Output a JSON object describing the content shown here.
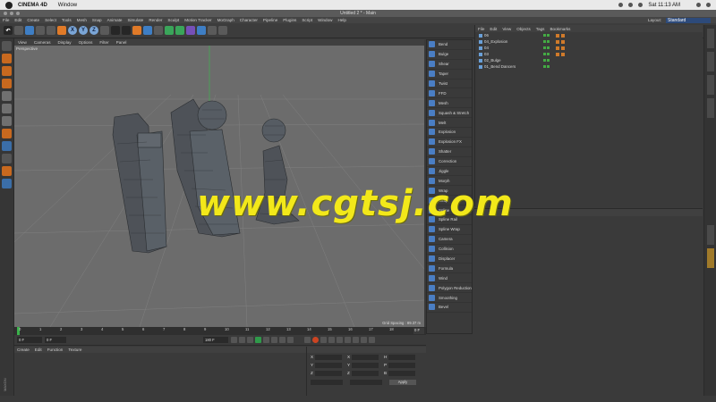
{
  "macbar": {
    "app_name": "CINEMA 4D",
    "menu": [
      "Window"
    ],
    "clock": "Sat 11:13 AM"
  },
  "window": {
    "title": "Untitled 2 * - Main"
  },
  "main_menu": {
    "items": [
      "File",
      "Edit",
      "Create",
      "Select",
      "Tools",
      "Mesh",
      "Snap",
      "Animate",
      "Simulate",
      "Render",
      "Sculpt",
      "Motion Tracker",
      "MoGraph",
      "Character",
      "Pipeline",
      "Plugins",
      "Script",
      "Window",
      "Help"
    ],
    "layout_label": "Layout:",
    "layout_value": "Standard"
  },
  "toolbar": {
    "axis_buttons": [
      "X",
      "Y",
      "Z"
    ]
  },
  "viewport": {
    "menu": [
      "View",
      "Cameras",
      "Display",
      "Options",
      "Filter",
      "Panel"
    ],
    "label": "Perspective",
    "grid_spacing": "Grid Spacing : 89.37 m"
  },
  "deformer_menu": {
    "items": [
      "Bend",
      "Bulge",
      "Shear",
      "Taper",
      "Twist",
      "FFD",
      "Mesh",
      "Squash & Stretch",
      "Melt",
      "Explosion",
      "Explosion FX",
      "Shatter",
      "Correction",
      "Jiggle",
      "Morph",
      "Wrap",
      "Wrap",
      "Spline",
      "Spline Rail",
      "Spline Wrap",
      "Camera",
      "Collision",
      "Displacer",
      "Formula",
      "Wind",
      "Polygon Reduction",
      "Smoothing",
      "Bevel"
    ]
  },
  "watermark": "www.cgtsj.com",
  "object_manager": {
    "menu": [
      "File",
      "Edit",
      "View",
      "Objects",
      "Tags",
      "Bookmarks"
    ],
    "objects": [
      "06",
      "04_Explosion",
      "04",
      "03",
      "02_Bulge",
      "01_Bend Dancers"
    ]
  },
  "timeline": {
    "ticks": [
      "0",
      "1",
      "2",
      "3",
      "4",
      "5",
      "6",
      "7",
      "8",
      "9",
      "10",
      "11",
      "12",
      "13",
      "14",
      "15",
      "16",
      "17",
      "18"
    ],
    "end_frame": "0 F"
  },
  "transport": {
    "current_frame": "0 F",
    "start_frame": "0 F",
    "end_frame": "180 F"
  },
  "material_manager": {
    "menu": [
      "Create",
      "Edit",
      "Function",
      "Texture"
    ]
  },
  "coordinates": {
    "rows": [
      {
        "a": "X",
        "b": "X",
        "c": "H"
      },
      {
        "a": "Y",
        "b": "Y",
        "c": "P"
      },
      {
        "a": "Z",
        "b": "Z",
        "c": "B"
      }
    ],
    "apply_label": "Apply"
  },
  "colors": {
    "viewport_bg": "#6c6c6c",
    "watermark": "#f2e81a",
    "deformer_icon": "#4a7ec4",
    "accent_orange": "#e07a28"
  }
}
